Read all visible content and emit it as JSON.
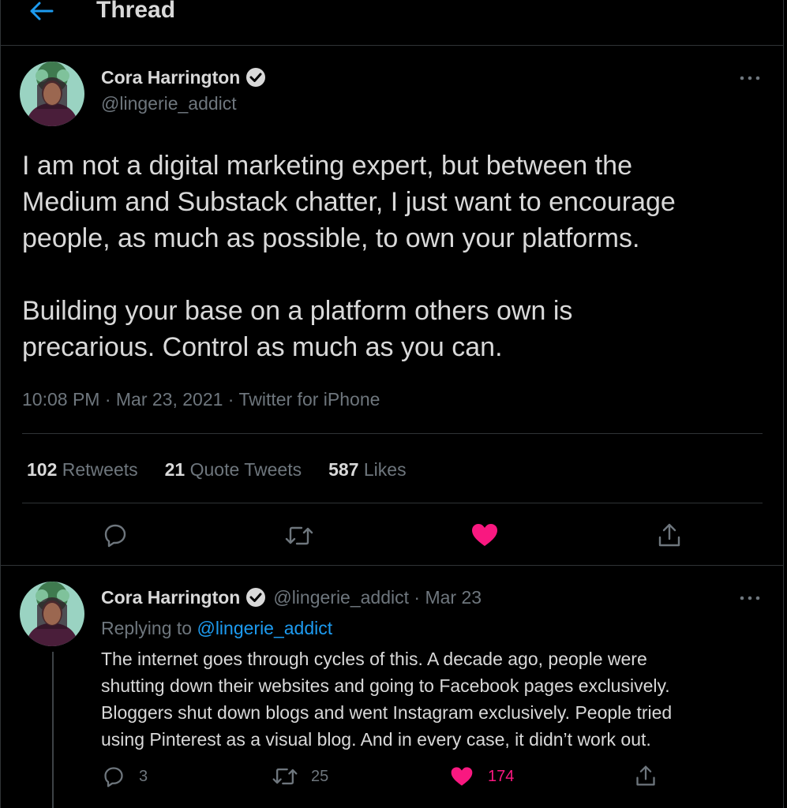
{
  "header": {
    "title": "Thread"
  },
  "main_tweet": {
    "author_name": "Cora Harrington",
    "handle": "@lingerie_addict",
    "text_lines": [
      "I am not a digital marketing expert, but between the",
      "Medium and Substack chatter, I just want to encourage",
      "people, as much as possible, to own your platforms."
    ],
    "text_lines_2": [
      "Building your base on a platform others own is",
      "precarious. Control as much as you can."
    ],
    "timestamp": "10:08 PM · Mar 23, 2021 · Twitter for iPhone",
    "stats": {
      "retweets_count": "102",
      "retweets_label": "Retweets",
      "quotes_count": "21",
      "quotes_label": "Quote Tweets",
      "likes_count": "587",
      "likes_label": "Likes"
    }
  },
  "reply_tweet": {
    "author_name": "Cora Harrington",
    "meta": "@lingerie_addict · Mar 23",
    "replying_prefix": "Replying to",
    "replying_handle": "@lingerie_addict",
    "text_lines": [
      "The internet goes through cycles of this. A decade ago, people were",
      "shutting down their websites and going to Facebook pages exclusively.",
      "Bloggers shut down blogs and went Instagram exclusively. People tried",
      "using Pinterest as a visual blog. And in every case, it didn’t work out."
    ],
    "actions": {
      "replies": "3",
      "retweets": "25",
      "likes": "174"
    }
  },
  "icons": [
    "back-arrow-icon",
    "verified-icon",
    "more-icon",
    "reply-icon",
    "retweet-icon",
    "like-icon",
    "share-icon"
  ],
  "colors": {
    "accent": "#1d9bf0",
    "like": "#f91880",
    "background": "#000000",
    "divider": "#2f3336"
  }
}
